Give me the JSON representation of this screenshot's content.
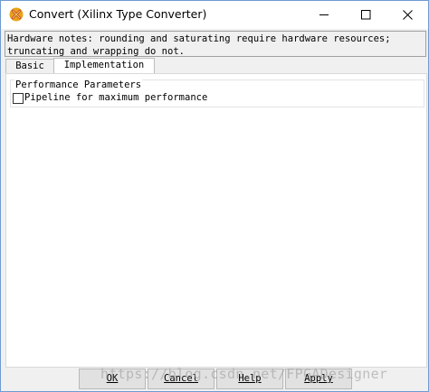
{
  "window": {
    "title": "Convert (Xilinx Type Converter)"
  },
  "notes": {
    "text": "Hardware notes: rounding and saturating require hardware resources; truncating and wrapping do not."
  },
  "tabs": [
    {
      "label": "Basic",
      "active": false
    },
    {
      "label": "Implementation",
      "active": true
    }
  ],
  "panel": {
    "group_title": "Performance Parameters",
    "checkbox_label": "Pipeline for maximum performance",
    "checkbox_checked": false
  },
  "buttons": {
    "ok": "OK",
    "cancel": "Cancel",
    "help": "Help",
    "apply": "Apply"
  },
  "watermark": "https://blog.csdn.net/FPGADesigner",
  "icons": {
    "app": "xilinx-logo-icon",
    "minimize": "minimize-icon",
    "maximize": "maximize-icon",
    "close": "close-icon"
  }
}
